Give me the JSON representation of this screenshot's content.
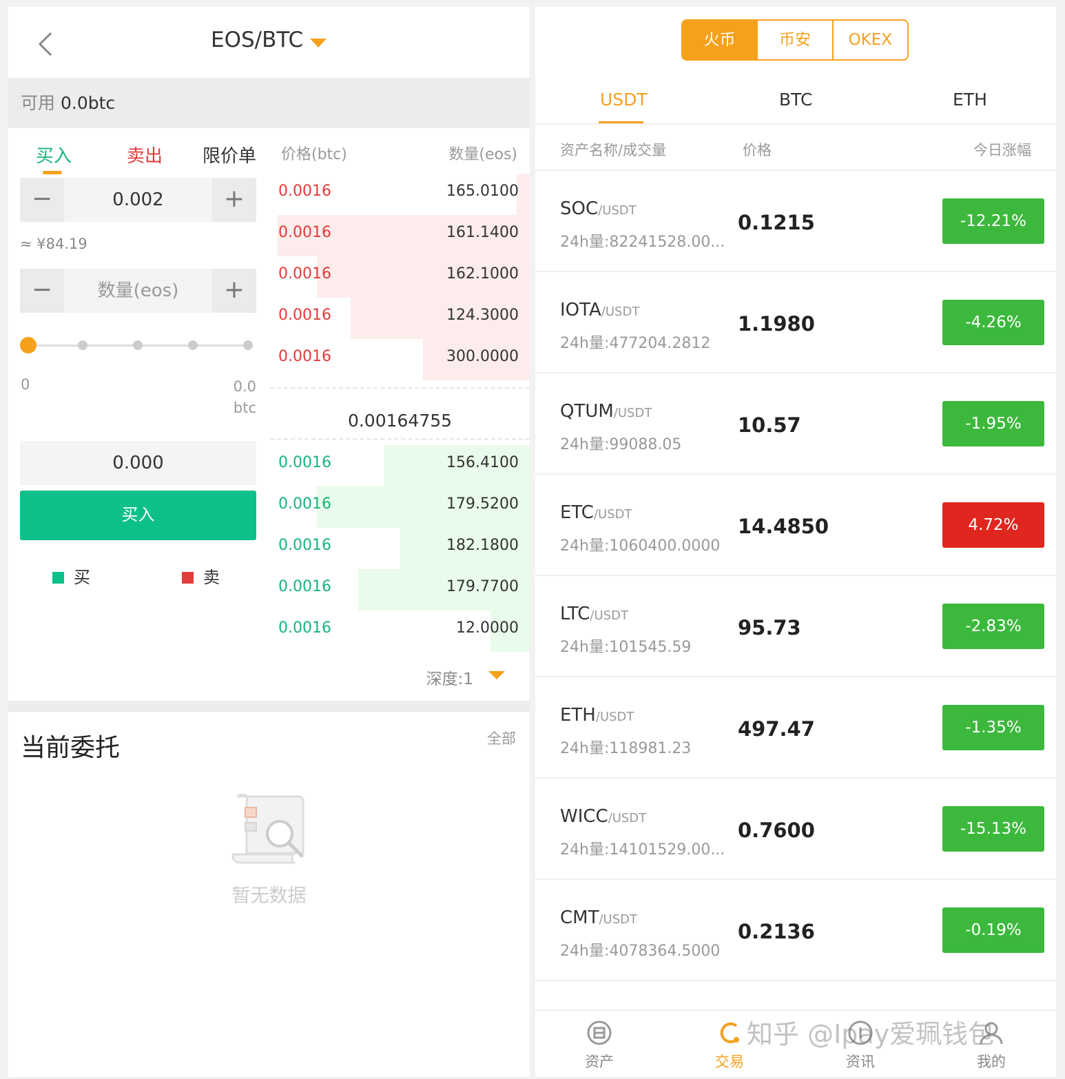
{
  "left": {
    "pair": "EOS/BTC",
    "available": {
      "label": "可用",
      "value": "0.0btc"
    },
    "tabs": {
      "buy": "买入",
      "sell": "卖出",
      "limit": "限价单"
    },
    "price": "0.002",
    "approx": "≈ ¥84.19",
    "qty_placeholder": "数量(eos)",
    "slider": {
      "min": "0",
      "max_value": "0.0",
      "max_unit": "btc",
      "level": 0
    },
    "total": "0.000",
    "buy_button": "买入",
    "legend": {
      "buy": "买",
      "sell": "卖"
    },
    "colors": {
      "buy": "#0dc089",
      "sell": "#e23b3b",
      "accent": "#f5a11c"
    },
    "book": {
      "price_header": "价格(btc)",
      "qty_header": "数量(eos)",
      "asks": [
        {
          "price": "0.0016",
          "qty": "165.0100",
          "depth": 0.05
        },
        {
          "price": "0.0016",
          "qty": "161.1400",
          "depth": 0.97
        },
        {
          "price": "0.0016",
          "qty": "162.1000",
          "depth": 0.82
        },
        {
          "price": "0.0016",
          "qty": "124.3000",
          "depth": 0.69
        },
        {
          "price": "0.0016",
          "qty": "300.0000",
          "depth": 0.41
        }
      ],
      "mid_price": "0.00164755",
      "bids": [
        {
          "price": "0.0016",
          "qty": "156.4100",
          "depth": 0.56
        },
        {
          "price": "0.0016",
          "qty": "179.5200",
          "depth": 0.82
        },
        {
          "price": "0.0016",
          "qty": "182.1800",
          "depth": 0.5
        },
        {
          "price": "0.0016",
          "qty": "179.7700",
          "depth": 0.66
        },
        {
          "price": "0.0016",
          "qty": "12.0000",
          "depth": 0.15
        }
      ],
      "depth_label": "深度:1"
    },
    "orders": {
      "title": "当前委托",
      "all": "全部",
      "empty": "暂无数据"
    }
  },
  "right": {
    "exchanges": [
      "火币",
      "币安",
      "OKEX"
    ],
    "quote_tabs": [
      "USDT",
      "BTC",
      "ETH"
    ],
    "columns": {
      "name": "资产名称/成交量",
      "price": "价格",
      "change": "今日涨幅"
    },
    "rows": [
      {
        "sym": "SOC",
        "quote": "/USDT",
        "vol": "24h量:82241528.00...",
        "price": "0.1215",
        "change": "-12.21%",
        "color": "#3cb93c"
      },
      {
        "sym": "IOTA",
        "quote": "/USDT",
        "vol": "24h量:477204.2812",
        "price": "1.1980",
        "change": "-4.26%",
        "color": "#3cb93c"
      },
      {
        "sym": "QTUM",
        "quote": "/USDT",
        "vol": "24h量:99088.05",
        "price": "10.57",
        "change": "-1.95%",
        "color": "#3cb93c"
      },
      {
        "sym": "ETC",
        "quote": "/USDT",
        "vol": "24h量:1060400.0000",
        "price": "14.4850",
        "change": "4.72%",
        "color": "#e0271f"
      },
      {
        "sym": "LTC",
        "quote": "/USDT",
        "vol": "24h量:101545.59",
        "price": "95.73",
        "change": "-2.83%",
        "color": "#3cb93c"
      },
      {
        "sym": "ETH",
        "quote": "/USDT",
        "vol": "24h量:118981.23",
        "price": "497.47",
        "change": "-1.35%",
        "color": "#3cb93c"
      },
      {
        "sym": "WICC",
        "quote": "/USDT",
        "vol": "24h量:14101529.00...",
        "price": "0.7600",
        "change": "-15.13%",
        "color": "#3cb93c"
      },
      {
        "sym": "CMT",
        "quote": "/USDT",
        "vol": "24h量:4078364.5000",
        "price": "0.2136",
        "change": "-0.19%",
        "color": "#3cb93c"
      }
    ],
    "tabbar": [
      {
        "label": "资产",
        "icon": "assets-icon"
      },
      {
        "label": "交易",
        "icon": "trade-icon"
      },
      {
        "label": "资讯",
        "icon": "news-icon"
      },
      {
        "label": "我的",
        "icon": "profile-icon"
      }
    ]
  },
  "watermark": "知乎 @Ipay爱珮钱包"
}
